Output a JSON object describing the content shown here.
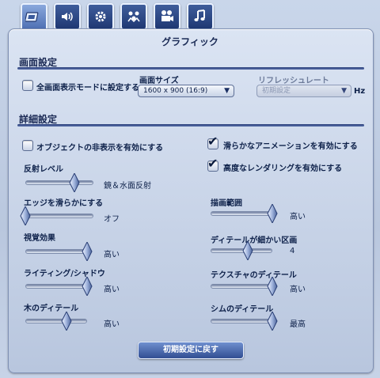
{
  "tabs": [
    {
      "icon": "graphics-icon",
      "active": true
    },
    {
      "icon": "sound-icon",
      "active": false
    },
    {
      "icon": "gear-icon",
      "active": false
    },
    {
      "icon": "sims-icon",
      "active": false
    },
    {
      "icon": "camera-icon",
      "active": false
    },
    {
      "icon": "music-note-icon",
      "active": false
    }
  ],
  "panel": {
    "title": "グラフィック"
  },
  "display": {
    "section_title": "画面設定",
    "fullscreen_label": "全画面表示モードに設定する",
    "fullscreen_checked": false,
    "resolution_label": "画面サイズ",
    "resolution_value": "1600 x 900 (16:9)",
    "refresh_label": "リフレッシュレート",
    "refresh_value": "初期設定",
    "refresh_unit": "Hz"
  },
  "advanced": {
    "section_title": "詳細設定",
    "hide_objects_label": "オブジェクトの非表示を有効にする",
    "hide_objects_checked": false,
    "smooth_anim_label": "滑らかなアニメーションを有効にする",
    "smooth_anim_checked": true,
    "hq_render_label": "高度なレンダリングを有効にする",
    "hq_render_checked": true
  },
  "sliders": {
    "reflection": {
      "label": "反射レベル",
      "value": "鏡＆水面反射",
      "level": 0.72
    },
    "edge": {
      "label": "エッジを滑らかにする",
      "value": "オフ",
      "level": 0.0
    },
    "visual": {
      "label": "視覚効果",
      "value": "高い",
      "level": 1.0
    },
    "lighting": {
      "label": "ライティング/シャドウ",
      "value": "高い",
      "level": 1.0
    },
    "tree": {
      "label": "木のディテール",
      "value": "高い",
      "level": 0.67
    },
    "draw_distance": {
      "label": "描画範囲",
      "value": "高い",
      "level": 1.0
    },
    "lot_detail": {
      "label": "ディテールが細かい区画",
      "value": "4",
      "level": 0.6
    },
    "texture": {
      "label": "テクスチャのディテール",
      "value": "高い",
      "level": 1.0
    },
    "sim_detail": {
      "label": "シムのディテール",
      "value": "最高",
      "level": 1.0
    }
  },
  "reset_button": "初期設定に戻す"
}
